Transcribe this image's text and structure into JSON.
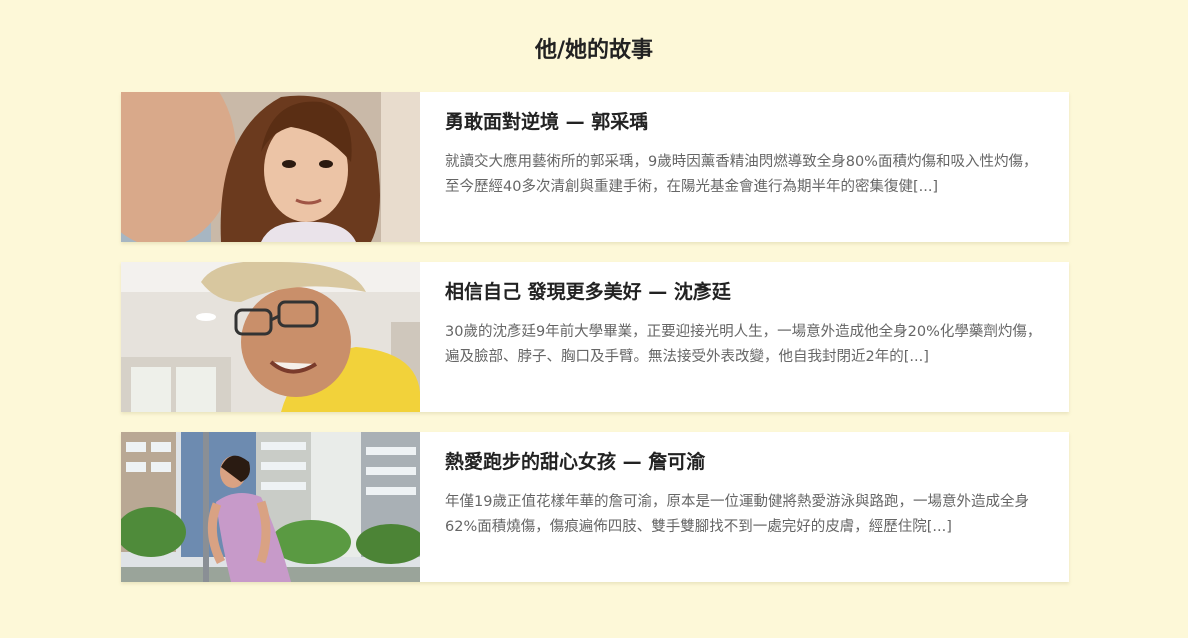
{
  "section": {
    "title": "他/她的故事"
  },
  "stories": [
    {
      "title": "勇敢面對逆境 — 郭采瑀",
      "excerpt": "就讀交大應用藝術所的郭采瑀，9歲時因薰香精油閃燃導致全身80%面積灼傷和吸入性灼傷，至今歷經40多次清創與重建手術，在陽光基金會進行為期半年的密集復健[...]"
    },
    {
      "title": "相信自己 發現更多美好 — 沈彥廷",
      "excerpt": "30歲的沈彥廷9年前大學畢業，正要迎接光明人生，一場意外造成他全身20%化學藥劑灼傷，遍及臉部、脖子、胸口及手臂。無法接受外表改變，他自我封閉近2年的[...]"
    },
    {
      "title": "熱愛跑步的甜心女孩 — 詹可渝",
      "excerpt": "年僅19歲正值花樣年華的詹可渝，原本是一位運動健將熱愛游泳與路跑，一場意外造成全身62%面積燒傷，傷痕遍佈四肢、雙手雙腳找不到一處完好的皮膚，經歷住院[...]"
    }
  ],
  "colors": {
    "page_background": "#fdf8d8",
    "card_background": "#ffffff",
    "title_text": "#222222",
    "excerpt_text": "#666666"
  }
}
